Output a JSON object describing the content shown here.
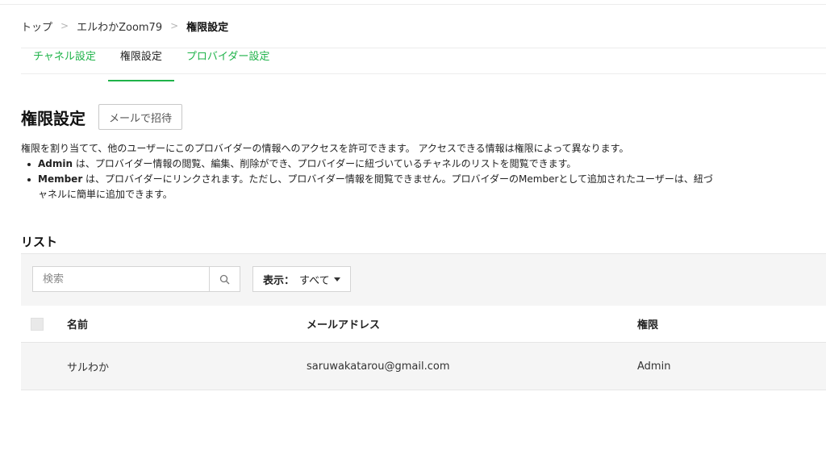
{
  "breadcrumb": {
    "items": [
      "トップ",
      "エルわかZoom79"
    ],
    "current": "権限設定",
    "separator": ">"
  },
  "tabs": [
    {
      "label": "チャネル設定",
      "active": false
    },
    {
      "label": "権限設定",
      "active": true
    },
    {
      "label": "プロバイダー設定",
      "active": false
    }
  ],
  "page": {
    "title": "権限設定",
    "invite_button": "メールで招待"
  },
  "description": {
    "intro": "権限を割り当てて、他のユーザーにこのプロバイダーの情報へのアクセスを許可できます。 アクセスできる情報は権限によって異なります。",
    "admin_term": "Admin",
    "admin_text": " は、プロバイダー情報の閲覧、編集、削除ができ、プロバイダーに紐づいているチャネルのリストを閲覧できます。",
    "member_term": "Member",
    "member_text_line1": " は、プロバイダーにリンクされます。ただし、プロバイダー情報を閲覧できません。プロバイダーのMemberとして追加されたユーザーは、紐づ",
    "member_text_line2": "ャネルに簡単に追加できます。"
  },
  "list": {
    "title": "リスト",
    "search_placeholder": "検索",
    "filter_label": "表示：",
    "filter_value": "すべて",
    "columns": {
      "name": "名前",
      "email": "メールアドレス",
      "role": "権限"
    },
    "rows": [
      {
        "name": "サルわか",
        "email": "saruwakatarou@gmail.com",
        "role": "Admin"
      }
    ]
  },
  "colors": {
    "accent": "#1fb34a"
  }
}
